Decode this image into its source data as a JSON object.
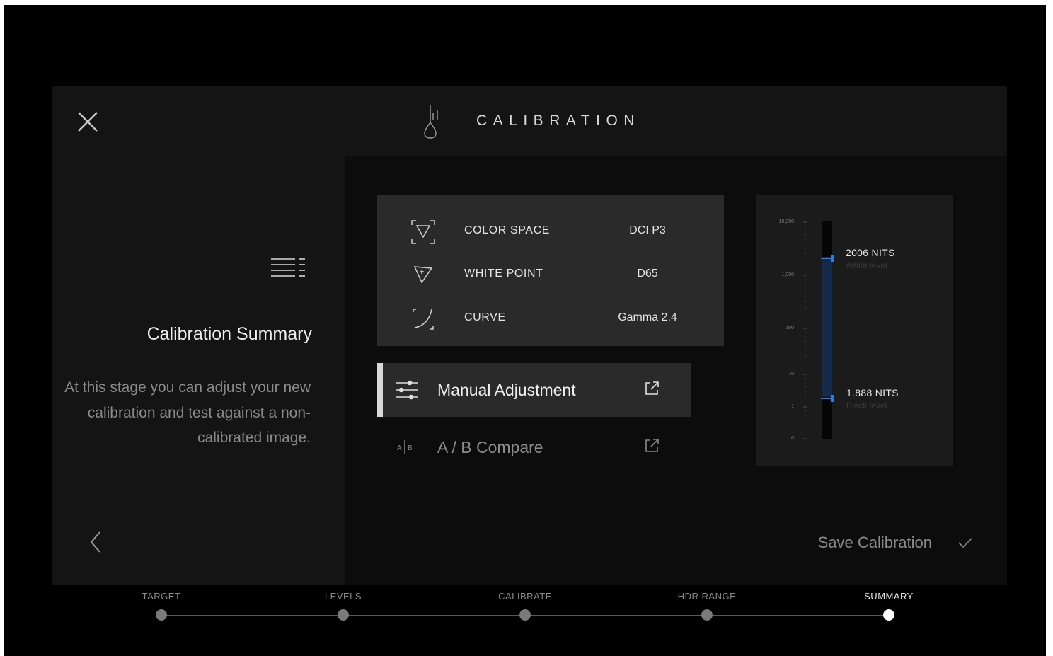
{
  "header": {
    "title": "CALIBRATION",
    "close_icon": "close-icon",
    "logo_icon": "pencil-drop-icon"
  },
  "summary": {
    "icon": "list-icon",
    "title": "Calibration Summary",
    "description": "At this stage you can adjust your new calibration and test against a non-calibrated image.",
    "back_icon": "chevron-left-icon"
  },
  "settings": [
    {
      "icon": "color-space-icon",
      "label": "COLOR SPACE",
      "value": "DCI P3"
    },
    {
      "icon": "white-point-icon",
      "label": "WHITE POINT",
      "value": "D65"
    },
    {
      "icon": "curve-icon",
      "label": "CURVE",
      "value": "Gamma 2.4"
    }
  ],
  "actions": [
    {
      "icon": "sliders-icon",
      "label": "Manual Adjustment",
      "active": true,
      "trailing_icon": "external-link-icon"
    },
    {
      "icon": "ab-compare-icon",
      "label": "A / B Compare",
      "active": false,
      "trailing_icon": "external-link-icon"
    }
  ],
  "hdr_range": {
    "scale": [
      "10,000",
      "1,000",
      "100",
      "10",
      "1",
      "0"
    ],
    "white": {
      "value": "2006 NITS",
      "label": "White level"
    },
    "black": {
      "value": "1.888 NITS",
      "label": "Black level"
    },
    "accent_color": "#2f7de1",
    "fill_color": "#142a4a"
  },
  "save": {
    "label": "Save Calibration",
    "icon": "check-icon"
  },
  "steps": [
    {
      "label": "TARGET",
      "current": false
    },
    {
      "label": "LEVELS",
      "current": false
    },
    {
      "label": "CALIBRATE",
      "current": false
    },
    {
      "label": "HDR RANGE",
      "current": false
    },
    {
      "label": "SUMMARY",
      "current": true
    }
  ]
}
